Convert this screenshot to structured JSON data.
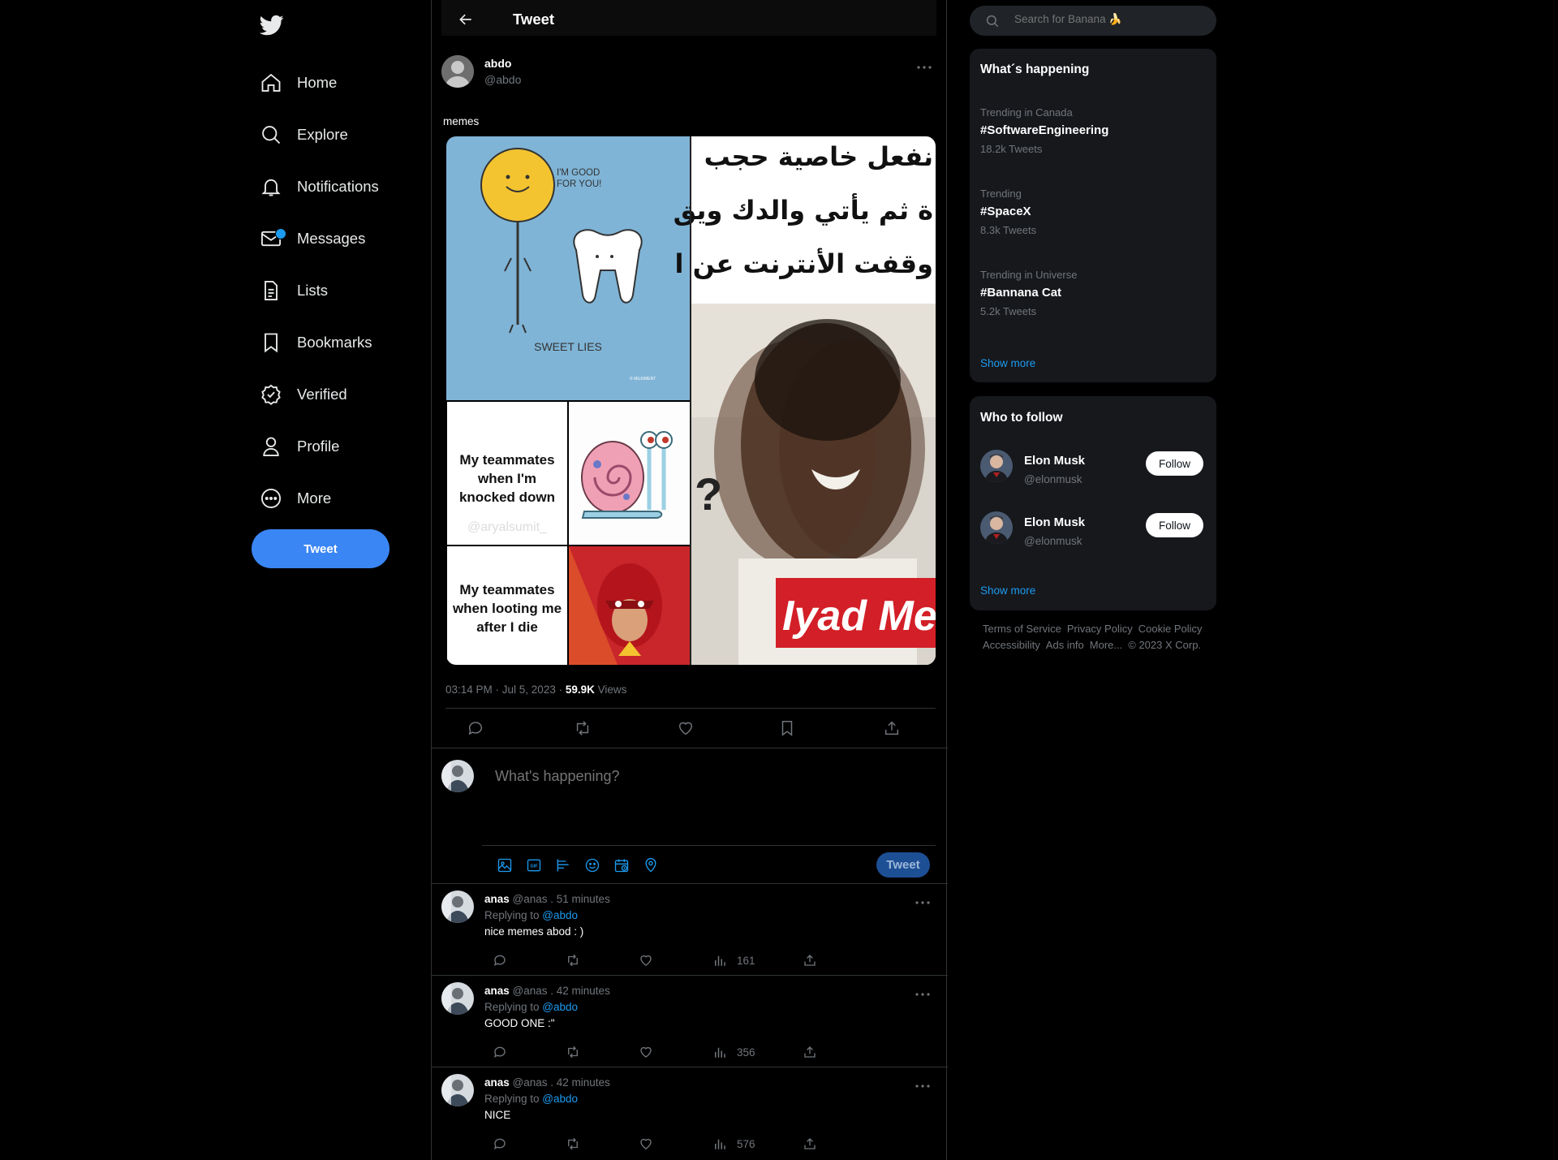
{
  "nav": {
    "items": [
      {
        "label": "Home",
        "icon": "home-icon"
      },
      {
        "label": "Explore",
        "icon": "search-icon"
      },
      {
        "label": "Notifications",
        "icon": "bell-icon"
      },
      {
        "label": "Messages",
        "icon": "envelope-icon"
      },
      {
        "label": "Lists",
        "icon": "list-icon"
      },
      {
        "label": "Bookmarks",
        "icon": "bookmark-icon"
      },
      {
        "label": "Verified",
        "icon": "verified-icon"
      },
      {
        "label": "Profile",
        "icon": "person-icon"
      },
      {
        "label": "More",
        "icon": "more-circle-icon"
      }
    ],
    "tweet_button": "Tweet",
    "accent": "#3a86f4"
  },
  "header": {
    "title": "Tweet"
  },
  "tweet": {
    "author_name": "abdo",
    "author_handle": "@abdo",
    "text": "memes",
    "media": {
      "panel1_text_1": "I'M GOOD",
      "panel1_text_2": "FOR YOU!",
      "panel1_caption": "SWEET LIES",
      "panel1_credit": "© MILKIMENT",
      "panel2_line_1": "My teammates",
      "panel2_line_2": "when I'm",
      "panel2_line_3": "knocked down",
      "panel2_watermark": "@aryalsumit_",
      "panel2_line_4": "My teammates",
      "panel2_line_5": "when looting me",
      "panel2_line_6": "after I die",
      "panel3_line_1": "نفعل خاصية حجب",
      "panel3_line_2": "ة ثم يأتي والدك ويق",
      "panel3_line_3": "وقفت الأنترنت عن ا",
      "panel3_banner": "Iyad Me",
      "panel3_mark": "?"
    },
    "time": "03:14 PM · Jul 5, 2023 · ",
    "views_count": "59.9K",
    "views_label": " Views"
  },
  "composer": {
    "placeholder": "What's happening?",
    "tweet_button": "Tweet"
  },
  "replies": [
    {
      "name": "anas",
      "meta": "@anas . 51 minutes",
      "replying_label": "Replying to ",
      "replying_to": "@abdo",
      "text": "nice memes abod : )",
      "views": "161"
    },
    {
      "name": "anas",
      "meta": "@anas . 42 minutes",
      "replying_label": "Replying to ",
      "replying_to": "@abdo",
      "text": "GOOD ONE :\"",
      "views": "356"
    },
    {
      "name": "anas",
      "meta": "@anas . 42 minutes",
      "replying_label": "Replying to ",
      "replying_to": "@abdo",
      "text": "NICE",
      "views": "576"
    }
  ],
  "search": {
    "placeholder": "Search for Banana 🍌"
  },
  "trends": {
    "title": "What´s happening",
    "items": [
      {
        "context": "Trending in Canada",
        "name": "#SoftwareEngineering",
        "count": "18.2k Tweets"
      },
      {
        "context": "Trending",
        "name": "#SpaceX",
        "count": "8.3k Tweets"
      },
      {
        "context": "Trending in Universe",
        "name": "#Bannana Cat",
        "count": "5.2k Tweets"
      }
    ],
    "show_more": "Show more"
  },
  "who_to_follow": {
    "title": "Who to follow",
    "items": [
      {
        "name": "Elon Musk",
        "handle": "@elonmusk",
        "button": "Follow"
      },
      {
        "name": "Elon Musk",
        "handle": "@elonmusk",
        "button": "Follow"
      }
    ],
    "show_more": "Show more"
  },
  "footer": {
    "links": [
      "Terms of Service",
      "Privacy Policy",
      "Cookie Policy",
      "Accessibility",
      "Ads info",
      "More...",
      "© 2023 X Corp."
    ]
  }
}
